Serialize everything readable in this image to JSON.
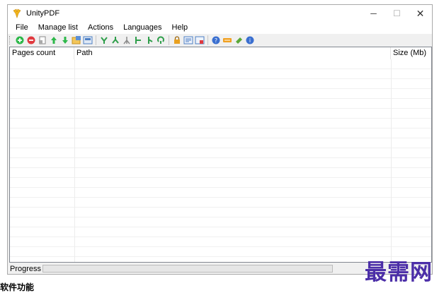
{
  "window": {
    "title": "UnityPDF",
    "controls": {
      "minimize": "─",
      "maximize": "☐",
      "close": "✕"
    }
  },
  "menu": {
    "items": [
      "File",
      "Manage list",
      "Actions",
      "Languages",
      "Help"
    ]
  },
  "toolbar": {
    "buttons": [
      {
        "icon": "add-icon",
        "color": "#2db84a"
      },
      {
        "icon": "remove-icon",
        "color": "#e0393e"
      },
      {
        "icon": "clear-list-icon",
        "color": "#8a8a8a"
      },
      {
        "icon": "move-up-icon",
        "color": "#2db84a"
      },
      {
        "icon": "move-down-icon",
        "color": "#2db84a"
      },
      {
        "icon": "open-folder-icon",
        "color": "#e8b23a"
      },
      {
        "icon": "save-list-icon",
        "color": "#4d7fc4"
      },
      {
        "icon": "merge-icon",
        "color": "#2e9e4a"
      },
      {
        "icon": "split-icon",
        "color": "#2e9e4a"
      },
      {
        "icon": "extract-icon",
        "color": "#8a8a8a"
      },
      {
        "icon": "branch-right-icon",
        "color": "#2e9e4a"
      },
      {
        "icon": "branch-down-icon",
        "color": "#2e9e4a"
      },
      {
        "icon": "rotate-icon",
        "color": "#2e9e4a"
      },
      {
        "icon": "lock-icon",
        "color": "#e8a020"
      },
      {
        "icon": "properties-icon",
        "color": "#4d7fc4"
      },
      {
        "icon": "options-icon",
        "color": "#4d7fc4"
      },
      {
        "icon": "help-icon",
        "color": "#3a6fd0"
      },
      {
        "icon": "register-icon",
        "color": "#f0a020"
      },
      {
        "icon": "donate-icon",
        "color": "#5aa838"
      },
      {
        "icon": "about-icon",
        "color": "#3a6fd0"
      }
    ]
  },
  "list": {
    "columns": [
      "Pages count",
      "Path",
      "Size (Mb)"
    ],
    "rows": []
  },
  "status": {
    "progress_label": "Progress :",
    "progress_fraction": 0
  },
  "watermark": "最需网",
  "below_text": "软件功能"
}
